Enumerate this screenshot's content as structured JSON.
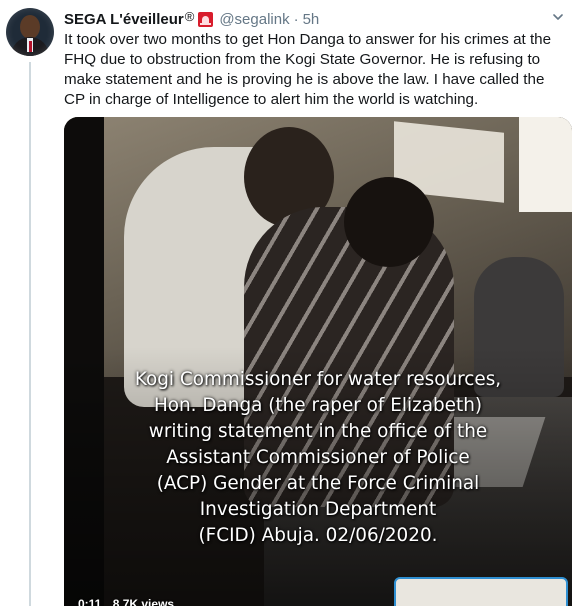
{
  "tweet": {
    "display_name": "SEGA L'éveilleur",
    "registered_mark": "®",
    "badge_icon": "police-light-icon",
    "handle": "@segalink",
    "separator": "·",
    "time": "5h",
    "text": "It took over two months to get Hon Danga to answer for his crimes at the FHQ due to obstruction from the Kogi State Governor. He is refusing to make statement and he is proving he is above the law. I have called the CP in charge of Intelligence to alert him the world is watching."
  },
  "media": {
    "caption_lines": [
      "Kogi Commissioner for water resources,",
      "Hon. Danga (the raper of Elizabeth)",
      "writing statement in the office of the",
      "Assistant Commissioner of Police",
      "(ACP) Gender at the Force Criminal",
      "Investigation Department",
      "(FCID) Abuja. 02/06/2020."
    ],
    "duration": "0:11",
    "views": "8.7K views"
  },
  "colors": {
    "secondary_text": "#657786",
    "thread_line": "#cfd9de",
    "badge": "#d81c2c"
  }
}
